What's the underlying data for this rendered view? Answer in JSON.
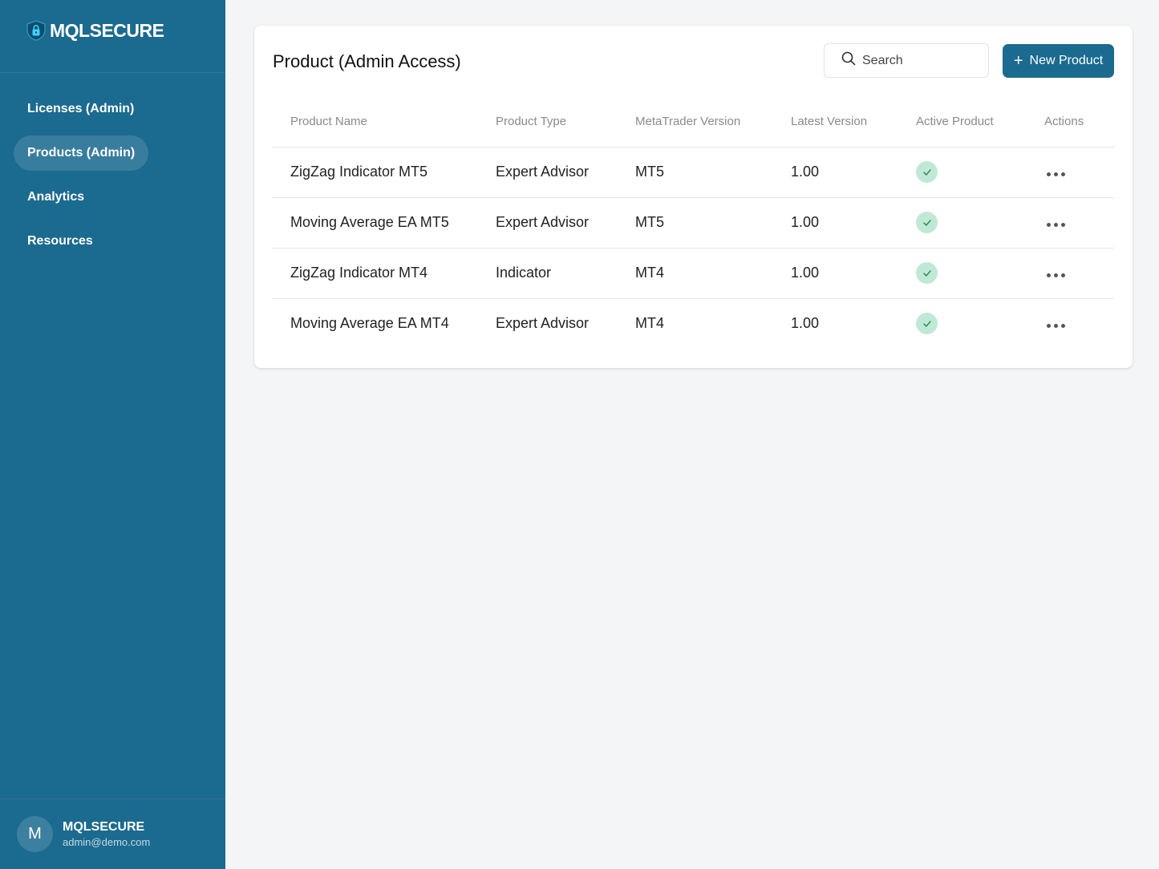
{
  "brand": {
    "name": "MQLSECURE",
    "logo_icon": "lock-icon"
  },
  "sidebar": {
    "items": [
      {
        "label": "Licenses (Admin)",
        "active": false
      },
      {
        "label": "Products (Admin)",
        "active": true
      },
      {
        "label": "Analytics",
        "active": false
      },
      {
        "label": "Resources",
        "active": false
      }
    ]
  },
  "user": {
    "initial": "M",
    "name": "MQLSECURE",
    "email": "admin@demo.com"
  },
  "page": {
    "title": "Product (Admin Access)",
    "search": {
      "placeholder": "Search",
      "value": ""
    },
    "new_button": {
      "label": "New Product"
    }
  },
  "table": {
    "headers": [
      "Product Name",
      "Product Type",
      "MetaTrader Version",
      "Latest Version",
      "Active Product",
      "Actions"
    ],
    "rows": [
      {
        "name": "ZigZag Indicator MT5",
        "type": "Expert Advisor",
        "mt_version": "MT5",
        "latest": "1.00",
        "active": true
      },
      {
        "name": "Moving Average EA MT5",
        "type": "Expert Advisor",
        "mt_version": "MT5",
        "latest": "1.00",
        "active": true
      },
      {
        "name": "ZigZag Indicator MT4",
        "type": "Indicator",
        "mt_version": "MT4",
        "latest": "1.00",
        "active": true
      },
      {
        "name": "Moving Average EA MT4",
        "type": "Expert Advisor",
        "mt_version": "MT4",
        "latest": "1.00",
        "active": true
      }
    ]
  },
  "colors": {
    "sidebar": "#1b6a8f",
    "accent": "#1b6a8f",
    "active_badge": "#bfe9d6",
    "check": "#2e8b5e"
  }
}
